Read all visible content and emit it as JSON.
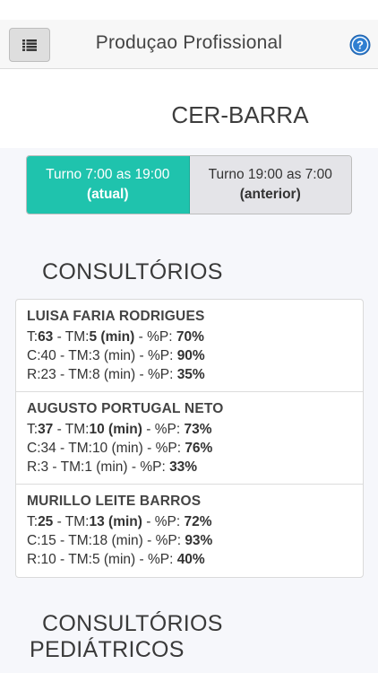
{
  "header": {
    "title": "Produçao Profissional",
    "menu_icon": "list-icon",
    "help_icon": "question-circle-icon"
  },
  "unit": {
    "name": "CER-BARRA"
  },
  "shifts": [
    {
      "time": "Turno 7:00 as 19:00",
      "tag": "(atual)",
      "active": true
    },
    {
      "time": "Turno 19:00 as 7:00",
      "tag": "(anterior)",
      "active": false
    }
  ],
  "sections": {
    "consultorios": "CONSULTÓRIOS",
    "pediatricos_line1": "CONSULTÓRIOS",
    "pediatricos_line2": "PEDIÁTRICOS"
  },
  "professionals": [
    {
      "name": "LUISA FARIA RODRIGUES",
      "t": {
        "total": "63",
        "tm": "5",
        "p": "70%"
      },
      "c": {
        "total": "40",
        "tm": "3",
        "p": "90%"
      },
      "r": {
        "total": "23",
        "tm": "8",
        "p": "35%"
      }
    },
    {
      "name": "AUGUSTO PORTUGAL NETO",
      "t": {
        "total": "37",
        "tm": "10",
        "p": "73%"
      },
      "c": {
        "total": "34",
        "tm": "10",
        "p": "76%"
      },
      "r": {
        "total": "3",
        "tm": "1",
        "p": "33%"
      }
    },
    {
      "name": "MURILLO LEITE BARROS",
      "t": {
        "total": "25",
        "tm": "13",
        "p": "72%"
      },
      "c": {
        "total": "15",
        "tm": "18",
        "p": "93%"
      },
      "r": {
        "total": "10",
        "tm": "5",
        "p": "40%"
      }
    }
  ],
  "colors": {
    "accent": "#1fc3ad",
    "help": "#2f7fd1"
  }
}
